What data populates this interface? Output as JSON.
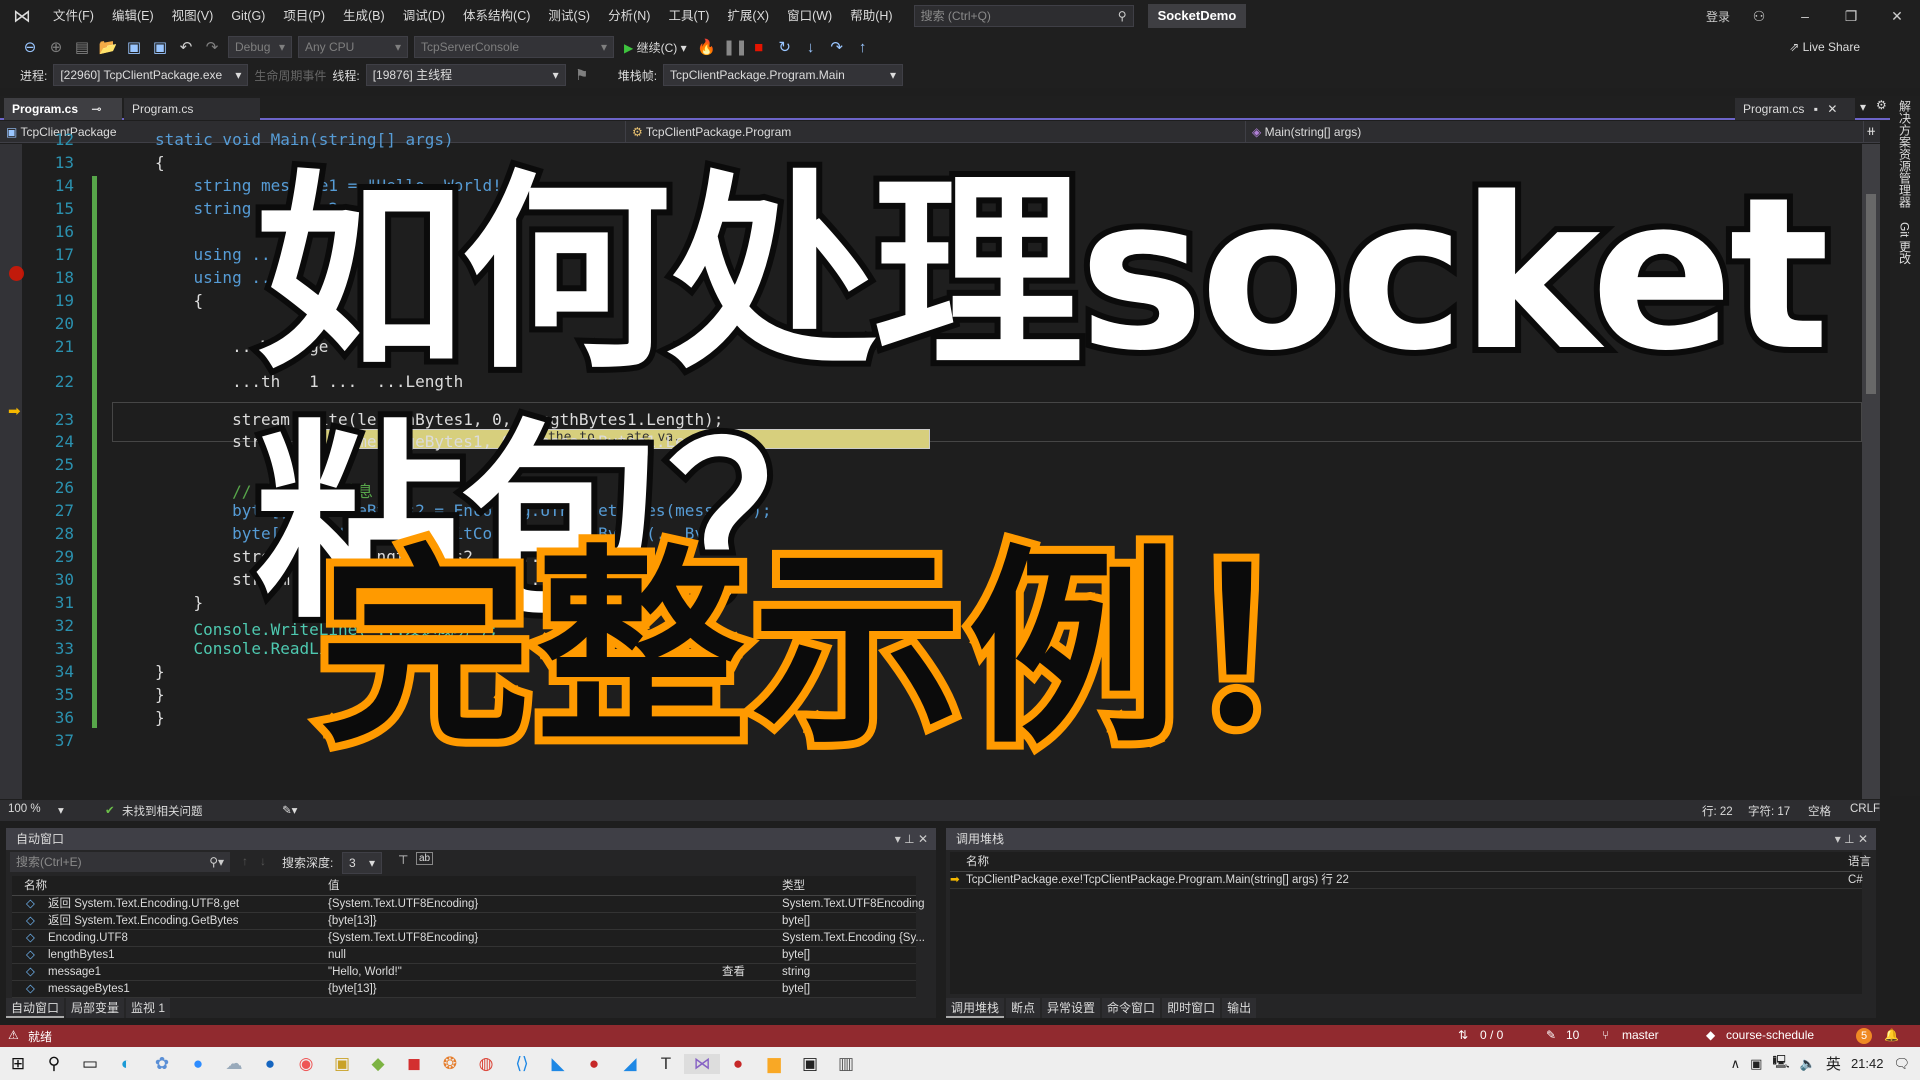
{
  "menubar": {
    "items": [
      "文件(F)",
      "编辑(E)",
      "视图(V)",
      "Git(G)",
      "项目(P)",
      "生成(B)",
      "调试(D)",
      "体系结构(C)",
      "测试(S)",
      "分析(N)",
      "工具(T)",
      "扩展(X)",
      "窗口(W)",
      "帮助(H)"
    ],
    "search_placeholder": "搜索 (Ctrl+Q)",
    "solution_name": "SocketDemo",
    "login": "登录"
  },
  "toolbar": {
    "config": "Debug",
    "platform": "Any CPU",
    "startup_project": "TcpServerConsole",
    "continue_label": "继续(C)",
    "live_share": "Live Share"
  },
  "debug_bar": {
    "process_label": "进程:",
    "process_value": "[22960] TcpClientPackage.exe",
    "lifecycle_label": "生命周期事件",
    "thread_label": "线程:",
    "thread_value": "[19876] 主线程",
    "stackframe_label": "堆栈帧:",
    "stackframe_value": "TcpClientPackage.Program.Main"
  },
  "tabs": {
    "active": "Program.cs",
    "second": "Program.cs",
    "preview": "Program.cs"
  },
  "navbar": {
    "project": "TcpClientPackage",
    "type": "TcpClientPackage.Program",
    "member": "Main(string[] args)"
  },
  "editor": {
    "lines": [
      {
        "n": "12",
        "text": "static void Main(string[] args)"
      },
      {
        "n": "13",
        "text": "{"
      },
      {
        "n": "14",
        "text": "    string message1 = \"Hello, World!\";"
      },
      {
        "n": "15",
        "text": "    string message2 = ..."
      },
      {
        "n": "16",
        "text": ""
      },
      {
        "n": "17",
        "text": "    using ..."
      },
      {
        "n": "18",
        "text": "    using ..."
      },
      {
        "n": "19",
        "text": "    {"
      },
      {
        "n": "20",
        "text": ""
      },
      {
        "n": "21",
        "text": "        ...Message"
      },
      {
        "n": "22",
        "text": "        ...th   1 ...  ...Length"
      },
      {
        "n": "23",
        "text": "        stream.Write(lengthBytes1, 0, lengthBytes1.Length);"
      },
      {
        "n": "24",
        "text": "        stream.Write(messageBytes1, 0, messageBytes1.Length);"
      },
      {
        "n": "25",
        "text": ""
      },
      {
        "n": "26",
        "text": "        // 发送第二个消息"
      },
      {
        "n": "27",
        "text": "        byte[] messageBytes2 = Encoding.UTF8.GetBytes(message2);"
      },
      {
        "n": "28",
        "text": "        byte[] lengthBytes2 = BitConverter.GetBytes(...Byte"
      },
      {
        "n": "29",
        "text": "        stream.Write(lengthBytes2, 0, ...);"
      },
      {
        "n": "30",
        "text": "        stream.Write(messageBytes2, 0, ...Length);"
      },
      {
        "n": "31",
        "text": "    }"
      },
      {
        "n": "32",
        "text": "    Console.WriteLine(\"...发送成功\");"
      },
      {
        "n": "33",
        "text": "    Console.ReadLine();"
      },
      {
        "n": "34",
        "text": "}"
      },
      {
        "n": "35",
        "text": "}"
      },
      {
        "n": "36",
        "text": "}"
      },
      {
        "n": "37",
        "text": ""
      }
    ],
    "tooltip": "...ck the to ...ate va..."
  },
  "overlay": {
    "title_line1": "如何处理socket粘包？",
    "title_line2": "完整示例！"
  },
  "editor_status": {
    "zoom": "100 %",
    "issues": "未找到相关问题",
    "line": "行: 22",
    "char": "字符: 17",
    "spaces": "空格",
    "eol": "CRLF"
  },
  "autos": {
    "title": "自动窗口",
    "search_placeholder": "搜索(Ctrl+E)",
    "depth_label": "搜索深度:",
    "depth_value": "3",
    "columns": [
      "名称",
      "值",
      "类型"
    ],
    "rows": [
      {
        "name": "返回 System.Text.Encoding.UTF8.get",
        "value": "{System.Text.UTF8Encoding}",
        "type": "System.Text.UTF8Encoding"
      },
      {
        "name": "返回 System.Text.Encoding.GetBytes",
        "value": "{byte[13]}",
        "type": "byte[]"
      },
      {
        "name": "Encoding.UTF8",
        "value": "{System.Text.UTF8Encoding}",
        "type": "System.Text.Encoding {Sy..."
      },
      {
        "name": "lengthBytes1",
        "value": "null",
        "type": "byte[]"
      },
      {
        "name": "message1",
        "value": "\"Hello, World!\"",
        "type": "string",
        "viewer": "查看"
      },
      {
        "name": "messageBytes1",
        "value": "{byte[13]}",
        "type": "byte[]"
      }
    ],
    "bottom_tabs": [
      "自动窗口",
      "局部变量",
      "监视 1"
    ]
  },
  "callstack": {
    "title": "调用堆栈",
    "columns": [
      "名称",
      "语言"
    ],
    "rows": [
      {
        "name": "TcpClientPackage.exe!TcpClientPackage.Program.Main(string[] args) 行 22",
        "lang": "C#"
      }
    ],
    "bottom_tabs": [
      "调用堆栈",
      "断点",
      "异常设置",
      "命令窗口",
      "即时窗口",
      "输出"
    ]
  },
  "statusbar": {
    "state": "就绪",
    "sync": "0 / 0",
    "changes": "10",
    "branch": "master",
    "repo": "course-schedule",
    "notifications": "5"
  },
  "right_rail": [
    "解决方案资源管理器",
    "Git 更改"
  ],
  "taskbar": {
    "ime": "英",
    "time": "21:42"
  }
}
